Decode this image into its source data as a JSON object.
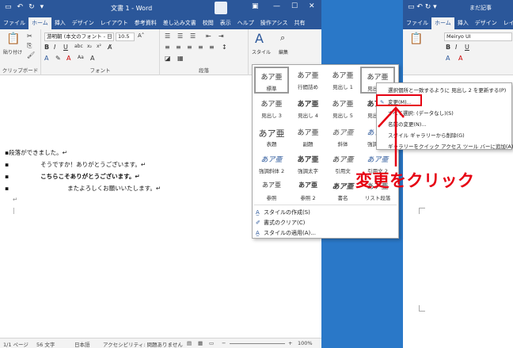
{
  "window": {
    "title": "文書 1 - Word",
    "tabs": [
      "ファイル",
      "ホーム",
      "挿入",
      "デザイン",
      "レイアウト",
      "参考資料",
      "差し込み文書",
      "校閲",
      "表示",
      "ヘルプ",
      "操作アシス",
      "共有"
    ],
    "active_tab": "ホーム"
  },
  "ribbon": {
    "clipboard": {
      "paste": "貼り付け",
      "label": "クリップボード"
    },
    "font": {
      "name": "游明朝 (本文のフォント - 日",
      "size": "10.5",
      "label": "フォント"
    },
    "paragraph": {
      "label": "段落"
    },
    "styles": {
      "label": "スタイル"
    },
    "editing": {
      "label": "編集"
    }
  },
  "document": {
    "lines": [
      "段落ができました。",
      "そうですか！ありがとうございます。",
      "こちらこそありがとうございます。",
      "またよろしくお願いいたします。"
    ]
  },
  "status_bar": {
    "page": "1/1 ページ",
    "words": "56 文字",
    "language": "日本語",
    "accessibility": "アクセシビリティ: 問題ありません",
    "zoom": "100%"
  },
  "style_gallery": {
    "sample": "あア亜",
    "styles": [
      "標準",
      "行間詰め",
      "見出し 1",
      "見出し 2",
      "見出し 3",
      "見出し 4",
      "見出し 5",
      "見出し 6",
      "表題",
      "副題",
      "斜体",
      "強調斜体",
      "強調斜体 2",
      "強調太字",
      "引用文",
      "引用文 2",
      "参照",
      "参照 2",
      "書名",
      "リスト段落"
    ],
    "menu": [
      "スタイルの作成(S)",
      "書式のクリア(C)",
      "スタイルの適用(A)..."
    ]
  },
  "context_menu": {
    "items": [
      "選択個所と一致するように 見出し 2 を更新する(P)",
      "変更(M)...",
      "すべて選択: (データなし)(S)",
      "名前の変更(N)...",
      "スタイル ギャラリーから削除(G)",
      "ギャラリーをクイック アクセス ツール バーに追加(A)"
    ]
  },
  "second_window": {
    "title": "まだ記事",
    "tabs": [
      "ファイル",
      "ホーム",
      "挿入",
      "デザイン",
      "レイアウ"
    ],
    "font": "Meiryo UI"
  },
  "annotation": {
    "callout": "変更をクリック",
    "color": "#e60012"
  },
  "colors": {
    "word_blue": "#2b579a",
    "ribbon": "#f3f3f3",
    "desktop": "#2a78c8"
  }
}
